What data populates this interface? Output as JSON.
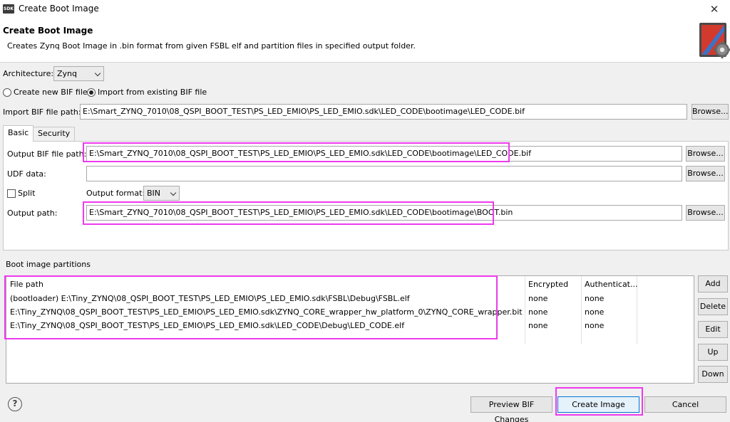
{
  "window": {
    "title": "Create Boot Image",
    "logo_text": "SDK",
    "close_glyph": "✕"
  },
  "header": {
    "title": "Create Boot Image",
    "description": "Creates Zynq Boot Image in .bin format from given FSBL elf and partition files in specified output folder.",
    "icon": "boot-image-gear-icon"
  },
  "architecture": {
    "label": "Architecture:",
    "value": "Zynq"
  },
  "bif_mode": {
    "create_label": "Create new BIF file",
    "import_label": "Import from existing BIF file",
    "selected": "import"
  },
  "import_bif": {
    "label": "Import BIF file path:",
    "value": "E:\\Smart_ZYNQ_7010\\08_QSPI_BOOT_TEST\\PS_LED_EMIO\\PS_LED_EMIO.sdk\\LED_CODE\\bootimage\\LED_CODE.bif",
    "browse": "Browse..."
  },
  "tabs": {
    "basic": "Basic",
    "security": "Security",
    "active": "basic"
  },
  "basic": {
    "output_bif_label": "Output BIF file path:",
    "output_bif_value": "E:\\Smart_ZYNQ_7010\\08_QSPI_BOOT_TEST\\PS_LED_EMIO\\PS_LED_EMIO.sdk\\LED_CODE\\bootimage\\LED_CODE.bif",
    "udf_label": "UDF data:",
    "udf_value": "",
    "split_label": "Split",
    "split_checked": false,
    "output_format_label": "Output format:",
    "output_format_value": "BIN",
    "output_path_label": "Output path:",
    "output_path_value": "E:\\Smart_ZYNQ_7010\\08_QSPI_BOOT_TEST\\PS_LED_EMIO\\PS_LED_EMIO.sdk\\LED_CODE\\bootimage\\BOOT.bin",
    "browse": "Browse..."
  },
  "partitions": {
    "section_label": "Boot image partitions",
    "columns": [
      "File path",
      "Encrypted",
      "Authenticat..."
    ],
    "rows": [
      [
        "(bootloader) E:\\Tiny_ZYNQ\\08_QSPI_BOOT_TEST\\PS_LED_EMIO\\PS_LED_EMIO.sdk\\FSBL\\Debug\\FSBL.elf",
        "none",
        "none"
      ],
      [
        "E:\\Tiny_ZYNQ\\08_QSPI_BOOT_TEST\\PS_LED_EMIO\\PS_LED_EMIO.sdk\\ZYNQ_CORE_wrapper_hw_platform_0\\ZYNQ_CORE_wrapper.bit",
        "none",
        "none"
      ],
      [
        "E:\\Tiny_ZYNQ\\08_QSPI_BOOT_TEST\\PS_LED_EMIO\\PS_LED_EMIO.sdk\\LED_CODE\\Debug\\LED_CODE.elf",
        "none",
        "none"
      ]
    ],
    "buttons": {
      "add": "Add",
      "delete": "Delete",
      "edit": "Edit",
      "up": "Up",
      "down": "Down"
    }
  },
  "footer": {
    "help_glyph": "?",
    "preview": "Preview BIF Changes",
    "create": "Create Image",
    "cancel": "Cancel"
  },
  "colors": {
    "highlight": "#ee3aee",
    "focus": "#0078d7"
  }
}
